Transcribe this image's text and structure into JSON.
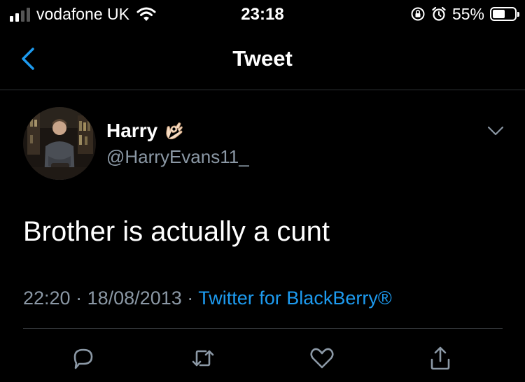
{
  "status_bar": {
    "carrier": "vodafone UK",
    "time": "23:18",
    "battery_percent": "55%",
    "battery_level": 0.55,
    "signal_bars": 4,
    "signal_bars_filled": 2
  },
  "nav": {
    "title": "Tweet",
    "back_icon": "chevron-left-icon"
  },
  "tweet": {
    "author_name": "Harry",
    "author_emoji": "👌",
    "handle": "@HarryEvans11_",
    "text": "Brother is actually a cunt",
    "time": "22:20",
    "date": "18/08/2013",
    "source": "Twitter for BlackBerry®"
  },
  "actions": [
    "reply-icon",
    "retweet-icon",
    "like-icon",
    "share-icon"
  ],
  "colors": {
    "background": "#000000",
    "text": "#ffffff",
    "secondary_text": "#8b98a5",
    "accent": "#1d9bf0",
    "divider": "#2f3336"
  }
}
